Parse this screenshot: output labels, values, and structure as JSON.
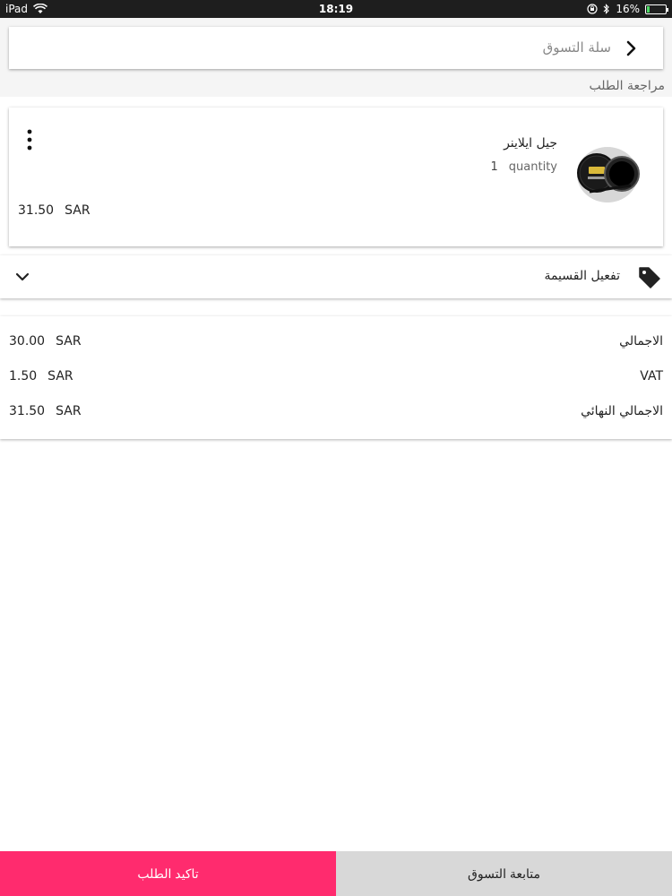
{
  "status_bar": {
    "device": "iPad",
    "time": "18:19",
    "battery_percent": "16%",
    "battery_level": 0.16,
    "icons": [
      "wifi-icon",
      "rotation-lock-icon",
      "bluetooth-icon",
      "battery-icon"
    ]
  },
  "header": {
    "title": "سلة التسوق",
    "back_icon": "chevron-right-icon"
  },
  "section_label": "مراجعة الطلب",
  "product": {
    "name": "جيل ايلاينر",
    "quantity_label": "quantity",
    "quantity": "1",
    "price": "31.50",
    "currency": "SAR",
    "image_icon": "eyeliner-gel-jar-image",
    "menu_icon": "more-vertical-icon"
  },
  "coupon": {
    "label": "تفعيل القسيمة",
    "icon": "tag-icon",
    "toggle_icon": "chevron-down-icon"
  },
  "totals": [
    {
      "label": "الاجمالي",
      "amount": "30.00",
      "currency": "SAR"
    },
    {
      "label": "VAT",
      "amount": "1.50",
      "currency": "SAR"
    },
    {
      "label": "الاجمالي النهائي",
      "amount": "31.50",
      "currency": "SAR"
    }
  ],
  "buttons": {
    "confirm_label": "تاكيد الطلب",
    "continue_label": "متابعة التسوق"
  },
  "colors": {
    "accent": "#ff2b6e",
    "secondary_button": "#d8d8d8",
    "status_bar": "#1e1e1e",
    "battery_fill": "#4cd964"
  }
}
